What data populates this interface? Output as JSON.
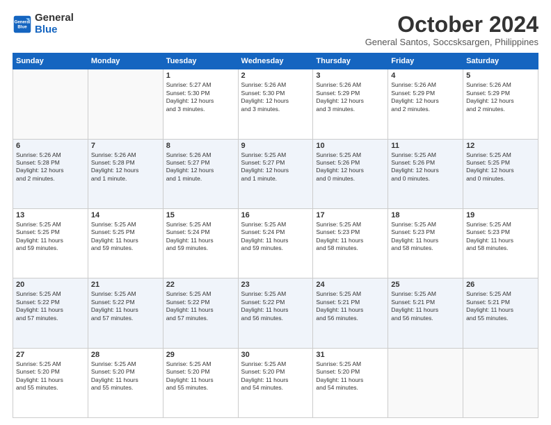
{
  "logo": {
    "line1": "General",
    "line2": "Blue"
  },
  "header": {
    "title": "October 2024",
    "subtitle": "General Santos, Soccsksargen, Philippines"
  },
  "weekdays": [
    "Sunday",
    "Monday",
    "Tuesday",
    "Wednesday",
    "Thursday",
    "Friday",
    "Saturday"
  ],
  "weeks": [
    [
      {
        "day": "",
        "info": ""
      },
      {
        "day": "",
        "info": ""
      },
      {
        "day": "1",
        "info": "Sunrise: 5:27 AM\nSunset: 5:30 PM\nDaylight: 12 hours\nand 3 minutes."
      },
      {
        "day": "2",
        "info": "Sunrise: 5:26 AM\nSunset: 5:30 PM\nDaylight: 12 hours\nand 3 minutes."
      },
      {
        "day": "3",
        "info": "Sunrise: 5:26 AM\nSunset: 5:29 PM\nDaylight: 12 hours\nand 3 minutes."
      },
      {
        "day": "4",
        "info": "Sunrise: 5:26 AM\nSunset: 5:29 PM\nDaylight: 12 hours\nand 2 minutes."
      },
      {
        "day": "5",
        "info": "Sunrise: 5:26 AM\nSunset: 5:29 PM\nDaylight: 12 hours\nand 2 minutes."
      }
    ],
    [
      {
        "day": "6",
        "info": "Sunrise: 5:26 AM\nSunset: 5:28 PM\nDaylight: 12 hours\nand 2 minutes."
      },
      {
        "day": "7",
        "info": "Sunrise: 5:26 AM\nSunset: 5:28 PM\nDaylight: 12 hours\nand 1 minute."
      },
      {
        "day": "8",
        "info": "Sunrise: 5:26 AM\nSunset: 5:27 PM\nDaylight: 12 hours\nand 1 minute."
      },
      {
        "day": "9",
        "info": "Sunrise: 5:25 AM\nSunset: 5:27 PM\nDaylight: 12 hours\nand 1 minute."
      },
      {
        "day": "10",
        "info": "Sunrise: 5:25 AM\nSunset: 5:26 PM\nDaylight: 12 hours\nand 0 minutes."
      },
      {
        "day": "11",
        "info": "Sunrise: 5:25 AM\nSunset: 5:26 PM\nDaylight: 12 hours\nand 0 minutes."
      },
      {
        "day": "12",
        "info": "Sunrise: 5:25 AM\nSunset: 5:25 PM\nDaylight: 12 hours\nand 0 minutes."
      }
    ],
    [
      {
        "day": "13",
        "info": "Sunrise: 5:25 AM\nSunset: 5:25 PM\nDaylight: 11 hours\nand 59 minutes."
      },
      {
        "day": "14",
        "info": "Sunrise: 5:25 AM\nSunset: 5:25 PM\nDaylight: 11 hours\nand 59 minutes."
      },
      {
        "day": "15",
        "info": "Sunrise: 5:25 AM\nSunset: 5:24 PM\nDaylight: 11 hours\nand 59 minutes."
      },
      {
        "day": "16",
        "info": "Sunrise: 5:25 AM\nSunset: 5:24 PM\nDaylight: 11 hours\nand 59 minutes."
      },
      {
        "day": "17",
        "info": "Sunrise: 5:25 AM\nSunset: 5:23 PM\nDaylight: 11 hours\nand 58 minutes."
      },
      {
        "day": "18",
        "info": "Sunrise: 5:25 AM\nSunset: 5:23 PM\nDaylight: 11 hours\nand 58 minutes."
      },
      {
        "day": "19",
        "info": "Sunrise: 5:25 AM\nSunset: 5:23 PM\nDaylight: 11 hours\nand 58 minutes."
      }
    ],
    [
      {
        "day": "20",
        "info": "Sunrise: 5:25 AM\nSunset: 5:22 PM\nDaylight: 11 hours\nand 57 minutes."
      },
      {
        "day": "21",
        "info": "Sunrise: 5:25 AM\nSunset: 5:22 PM\nDaylight: 11 hours\nand 57 minutes."
      },
      {
        "day": "22",
        "info": "Sunrise: 5:25 AM\nSunset: 5:22 PM\nDaylight: 11 hours\nand 57 minutes."
      },
      {
        "day": "23",
        "info": "Sunrise: 5:25 AM\nSunset: 5:22 PM\nDaylight: 11 hours\nand 56 minutes."
      },
      {
        "day": "24",
        "info": "Sunrise: 5:25 AM\nSunset: 5:21 PM\nDaylight: 11 hours\nand 56 minutes."
      },
      {
        "day": "25",
        "info": "Sunrise: 5:25 AM\nSunset: 5:21 PM\nDaylight: 11 hours\nand 56 minutes."
      },
      {
        "day": "26",
        "info": "Sunrise: 5:25 AM\nSunset: 5:21 PM\nDaylight: 11 hours\nand 55 minutes."
      }
    ],
    [
      {
        "day": "27",
        "info": "Sunrise: 5:25 AM\nSunset: 5:20 PM\nDaylight: 11 hours\nand 55 minutes."
      },
      {
        "day": "28",
        "info": "Sunrise: 5:25 AM\nSunset: 5:20 PM\nDaylight: 11 hours\nand 55 minutes."
      },
      {
        "day": "29",
        "info": "Sunrise: 5:25 AM\nSunset: 5:20 PM\nDaylight: 11 hours\nand 55 minutes."
      },
      {
        "day": "30",
        "info": "Sunrise: 5:25 AM\nSunset: 5:20 PM\nDaylight: 11 hours\nand 54 minutes."
      },
      {
        "day": "31",
        "info": "Sunrise: 5:25 AM\nSunset: 5:20 PM\nDaylight: 11 hours\nand 54 minutes."
      },
      {
        "day": "",
        "info": ""
      },
      {
        "day": "",
        "info": ""
      }
    ]
  ]
}
